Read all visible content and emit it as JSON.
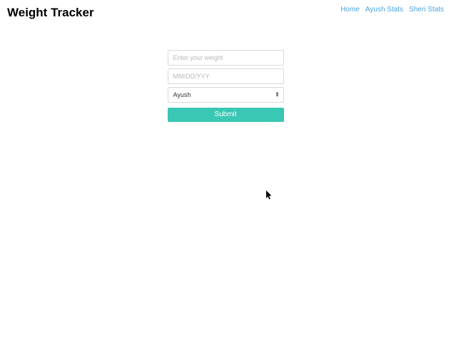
{
  "header": {
    "title": "Weight Tracker",
    "nav": {
      "home": "Home",
      "ayush_stats": "Ayush Stats",
      "sheri_stats": "Sheri Stats"
    }
  },
  "form": {
    "weight_placeholder": "Enter your weight",
    "date_placeholder": "MM/DD/YYY",
    "person_selected": "Ayush",
    "submit_label": "Submit"
  }
}
